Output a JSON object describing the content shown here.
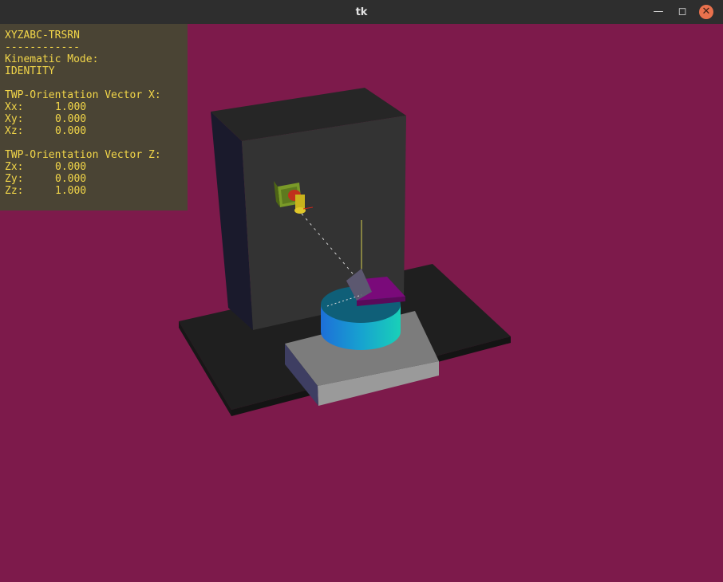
{
  "window": {
    "title": "tk",
    "minimize_icon": "minimize-icon",
    "maximize_icon": "maximize-icon",
    "close_icon": "close-icon"
  },
  "hud": {
    "machine": "XYZABC-TRSRN",
    "separator": "------------",
    "kinematic_label": "Kinematic Mode:",
    "kinematic_value": "IDENTITY",
    "vector_x_label": "TWP-Orientation Vector X:",
    "vector_x": [
      {
        "key": "Xx:",
        "value": "1.000"
      },
      {
        "key": "Xy:",
        "value": "0.000"
      },
      {
        "key": "Xz:",
        "value": "0.000"
      }
    ],
    "vector_z_label": "TWP-Orientation Vector Z:",
    "vector_z": [
      {
        "key": "Zx:",
        "value": "0.000"
      },
      {
        "key": "Zy:",
        "value": "0.000"
      },
      {
        "key": "Zz:",
        "value": "1.000"
      }
    ]
  },
  "colors": {
    "background": "#7d1a4b",
    "hud_background": "#4a4434",
    "hud_text": "#f2d649",
    "column": "#2f2f2f",
    "base_plate": "#1e1e1e",
    "table_slide": "#8a8a8a",
    "rotary_table": "#1aa6d6",
    "work_piece": "#8a0a8a"
  }
}
